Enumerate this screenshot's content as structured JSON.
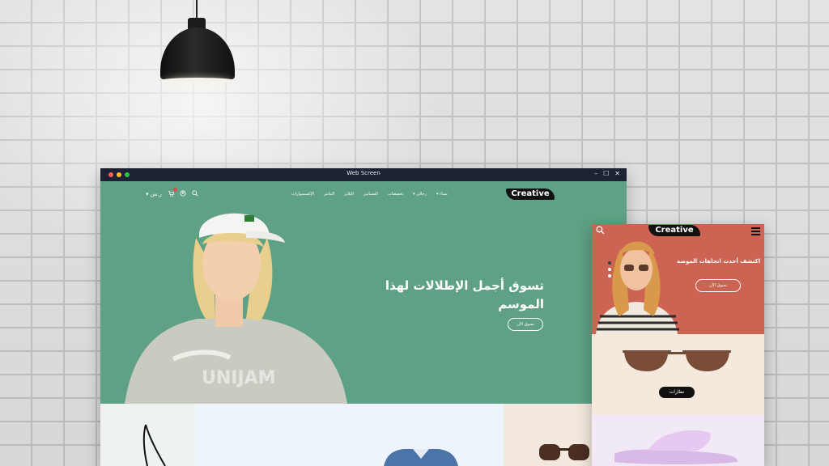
{
  "window": {
    "title": "Web Screen",
    "controls": [
      "–",
      "☐",
      "✕"
    ]
  },
  "brand": {
    "logo": "Creative"
  },
  "desktop": {
    "nav": {
      "menu": [
        "نساء",
        "رجالي",
        "تخفيضات",
        "الفساتين",
        "البلايز",
        "التنانير",
        "الإكسسوارات"
      ],
      "currency": "ر.س",
      "icons": [
        "search-icon",
        "user-icon",
        "cart-icon",
        "currency-dropdown"
      ]
    },
    "hero": {
      "headline_line1": "تسوق أجمل الإطلالات لهذا",
      "headline_line2": "الموسم",
      "button": "تسوق الآن",
      "bg_color": "#5fa184"
    }
  },
  "mobile": {
    "hero": {
      "heading": "اكتشف أحدث اتجاهات الموضة",
      "button": "تسوق الآن",
      "bg_color": "#cd6352"
    },
    "category_label": "نظارات"
  },
  "colors": {
    "titlebar": "#1c2233",
    "dot_red": "#ff5f57",
    "dot_yellow": "#febc2e",
    "dot_green": "#28c840"
  }
}
